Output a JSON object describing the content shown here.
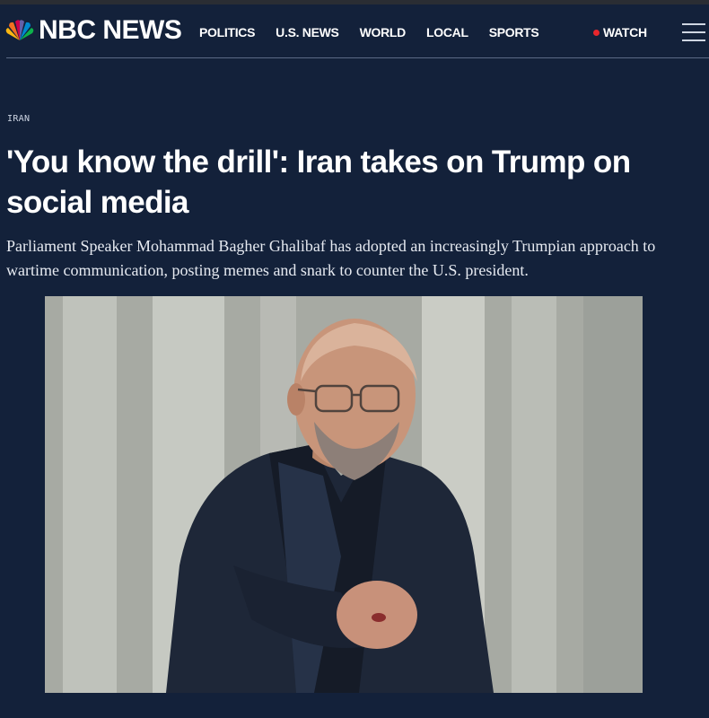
{
  "brand": {
    "logo_text": "NBC NEWS",
    "peacock_colors": [
      "#fcb711",
      "#f37021",
      "#cc004c",
      "#6460aa",
      "#0089d0",
      "#0db14b"
    ]
  },
  "nav": {
    "links": [
      "POLITICS",
      "U.S. NEWS",
      "WORLD",
      "LOCAL",
      "SPORTS"
    ],
    "watch_label": "WATCH",
    "live_dot_color": "#e8262c",
    "menu_icon": "hamburger-menu-icon"
  },
  "article": {
    "section": "IRAN",
    "headline": "'You know the drill': Iran takes on Trump on social media",
    "dek": "Parliament Speaker Mohammad Bagher Ghalibaf has adopted an increasingly Trumpian approach to wartime communication, posting memes and snark to counter the U.S. president."
  },
  "colors": {
    "background": "#13213a",
    "text": "#ffffff"
  }
}
